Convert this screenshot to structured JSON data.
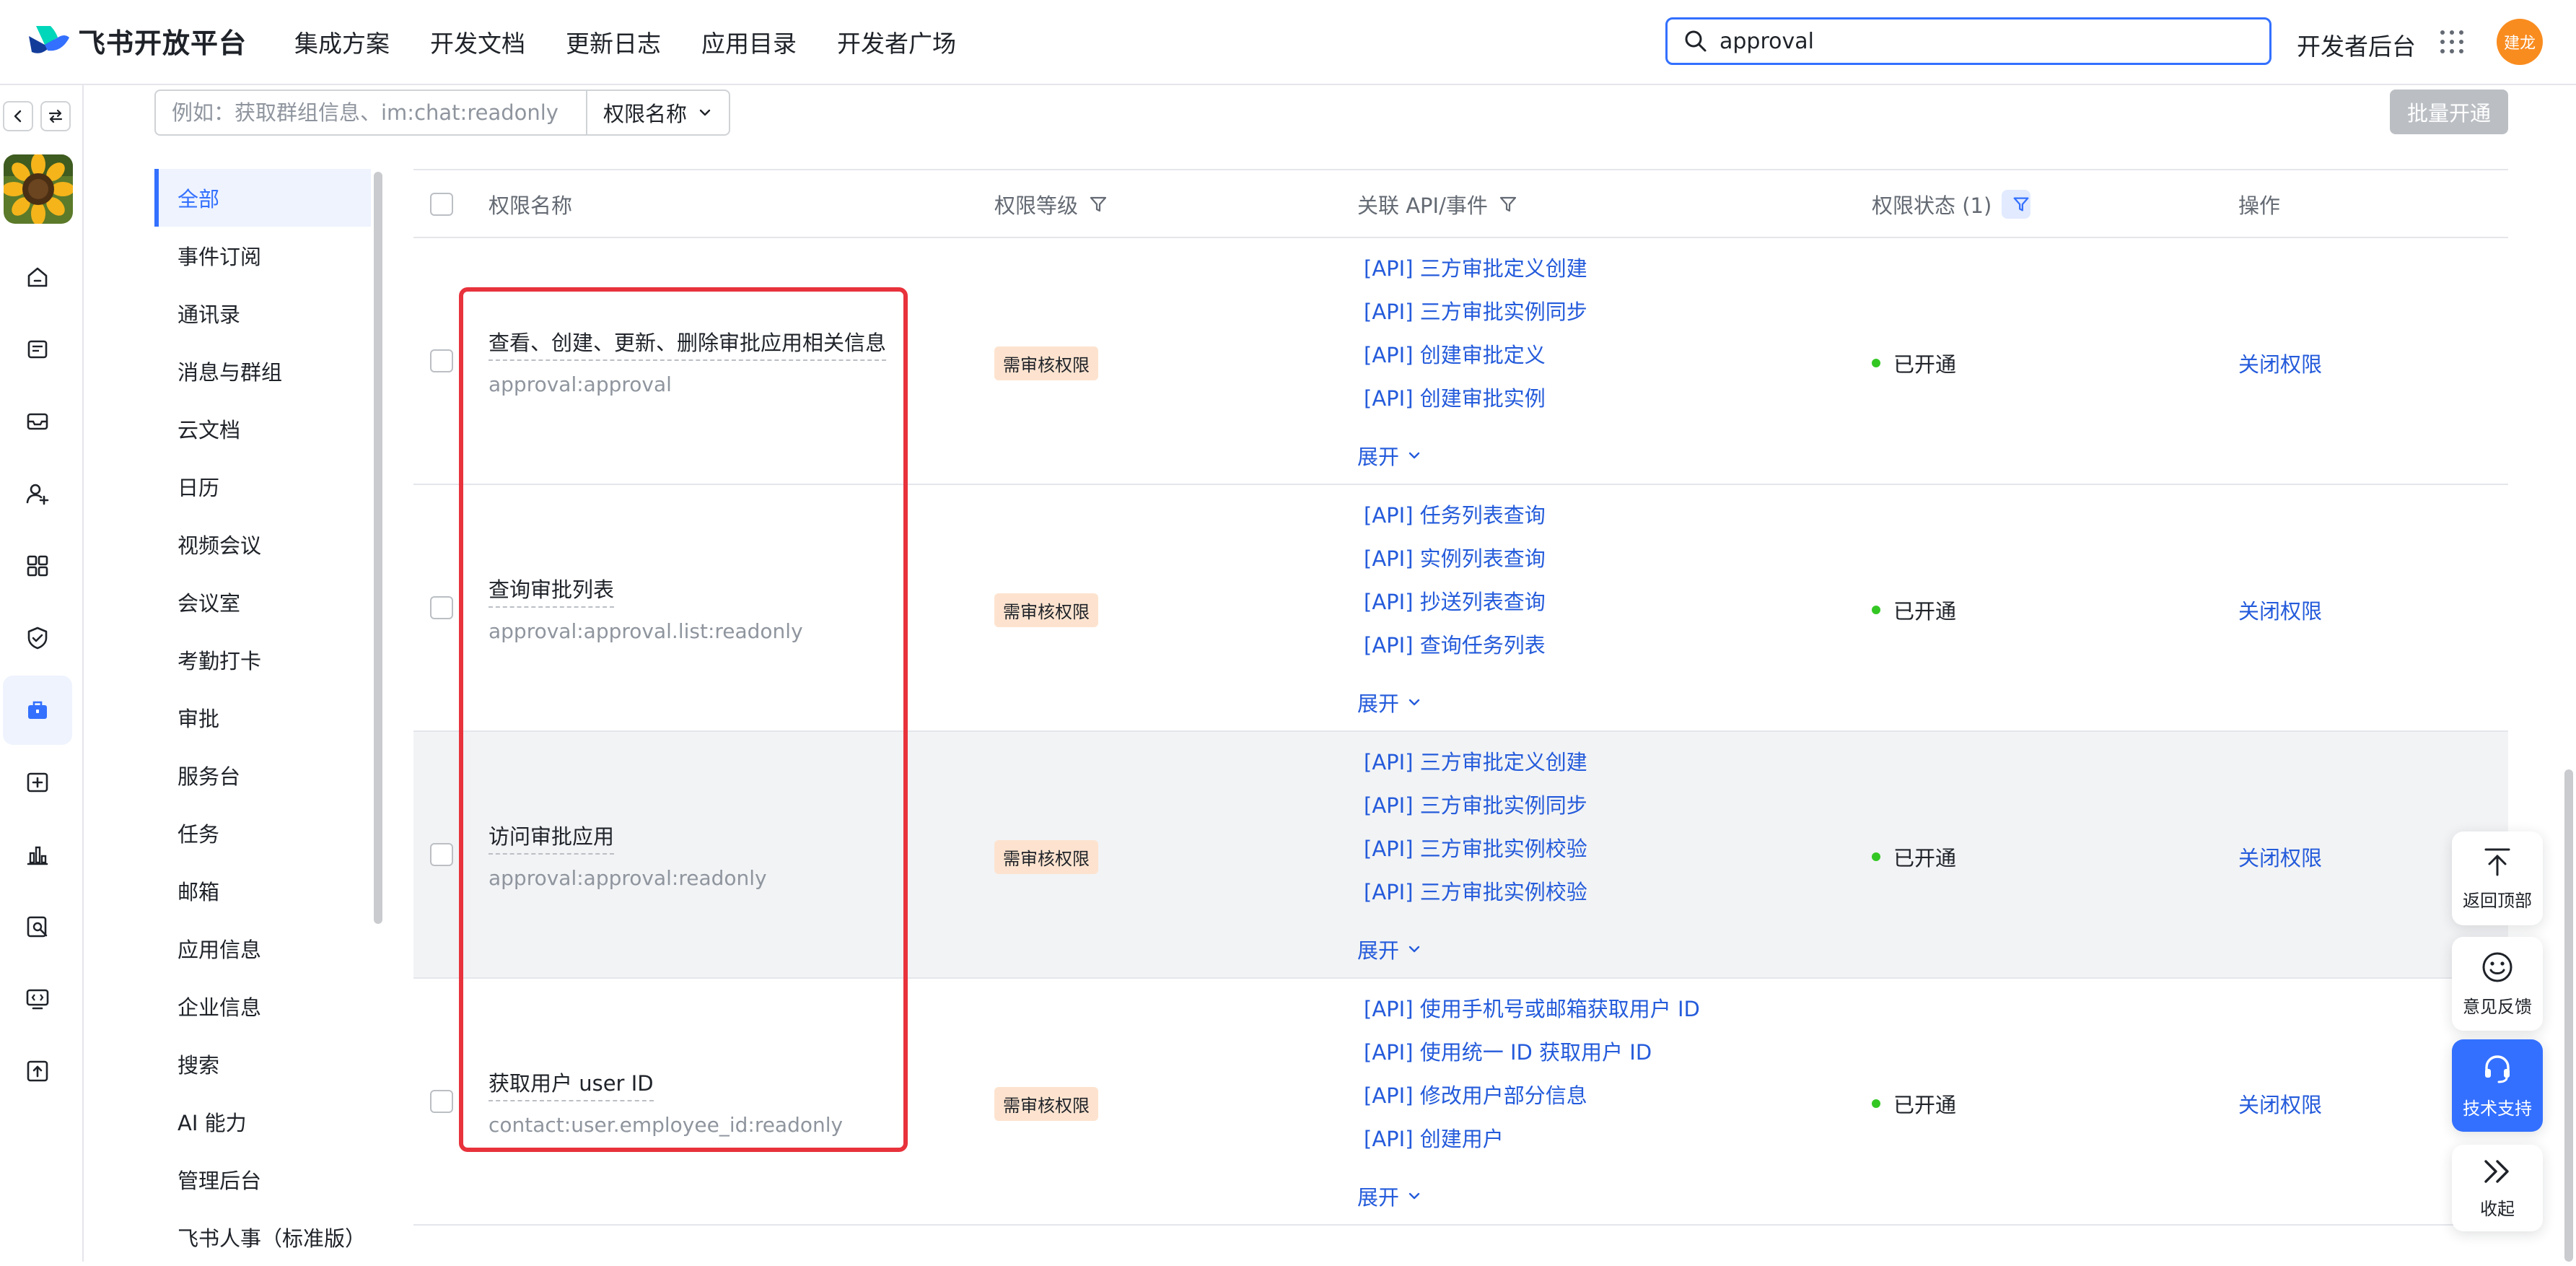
{
  "brand": {
    "name": "飞书开放平台"
  },
  "nav": {
    "items": [
      "集成方案",
      "开发文档",
      "更新日志",
      "应用目录",
      "开发者广场"
    ]
  },
  "search": {
    "value": "approval"
  },
  "header": {
    "console_label": "开发者后台",
    "avatar_text": "建龙"
  },
  "filter": {
    "placeholder": "例如：获取群组信息、im:chat:readonly",
    "select_value": "权限名称",
    "batch_button": "批量开通"
  },
  "categories": [
    "全部",
    "事件订阅",
    "通讯录",
    "消息与群组",
    "云文档",
    "日历",
    "视频会议",
    "会议室",
    "考勤打卡",
    "审批",
    "服务台",
    "任务",
    "邮箱",
    "应用信息",
    "企业信息",
    "搜索",
    "AI 能力",
    "管理后台",
    "飞书人事（标准版）"
  ],
  "table": {
    "headers": {
      "name": "权限名称",
      "level": "权限等级",
      "apis": "关联 API/事件",
      "status": "权限状态 (1)",
      "action": "操作"
    },
    "expand_label": "展开",
    "rows": [
      {
        "name": "查看、创建、更新、删除审批应用相关信息",
        "scope": "approval:approval",
        "level": "需审核权限",
        "apis": [
          "[API] 三方审批定义创建",
          "[API] 三方审批实例同步",
          "[API] 创建审批定义",
          "[API] 创建审批实例"
        ],
        "status": "已开通",
        "action": "关闭权限"
      },
      {
        "name": "查询审批列表",
        "scope": "approval:approval.list:readonly",
        "level": "需审核权限",
        "apis": [
          "[API] 任务列表查询",
          "[API] 实例列表查询",
          "[API] 抄送列表查询",
          "[API] 查询任务列表"
        ],
        "status": "已开通",
        "action": "关闭权限"
      },
      {
        "name": "访问审批应用",
        "scope": "approval:approval:readonly",
        "level": "需审核权限",
        "apis": [
          "[API] 三方审批定义创建",
          "[API] 三方审批实例同步",
          "[API] 三方审批实例校验",
          "[API] 三方审批实例校验"
        ],
        "status": "已开通",
        "action": "关闭权限"
      },
      {
        "name": "获取用户 user ID",
        "scope": "contact:user.employee_id:readonly",
        "level": "需审核权限",
        "apis": [
          "[API] 使用手机号或邮箱获取用户 ID",
          "[API] 使用统一 ID 获取用户 ID",
          "[API] 修改用户部分信息",
          "[API] 创建用户"
        ],
        "status": "已开通",
        "action": "关闭权限"
      }
    ]
  },
  "float_tools": {
    "back_top": "返回顶部",
    "feedback": "意见反馈",
    "support": "技术支持",
    "collapse": "收起"
  },
  "colors": {
    "accent": "#3370ff",
    "link": "#245bdb",
    "status_ok": "#34c724",
    "badge_bg": "#fde3cf",
    "highlight": "#e8323c"
  },
  "rail_icons": [
    "home-icon",
    "document-icon",
    "inbox-icon",
    "add-user-icon",
    "apps-grid-icon",
    "shield-icon",
    "briefcase-icon",
    "add-box-icon",
    "bar-chart-icon",
    "search-doc-icon",
    "monitor-code-icon",
    "upload-icon"
  ]
}
